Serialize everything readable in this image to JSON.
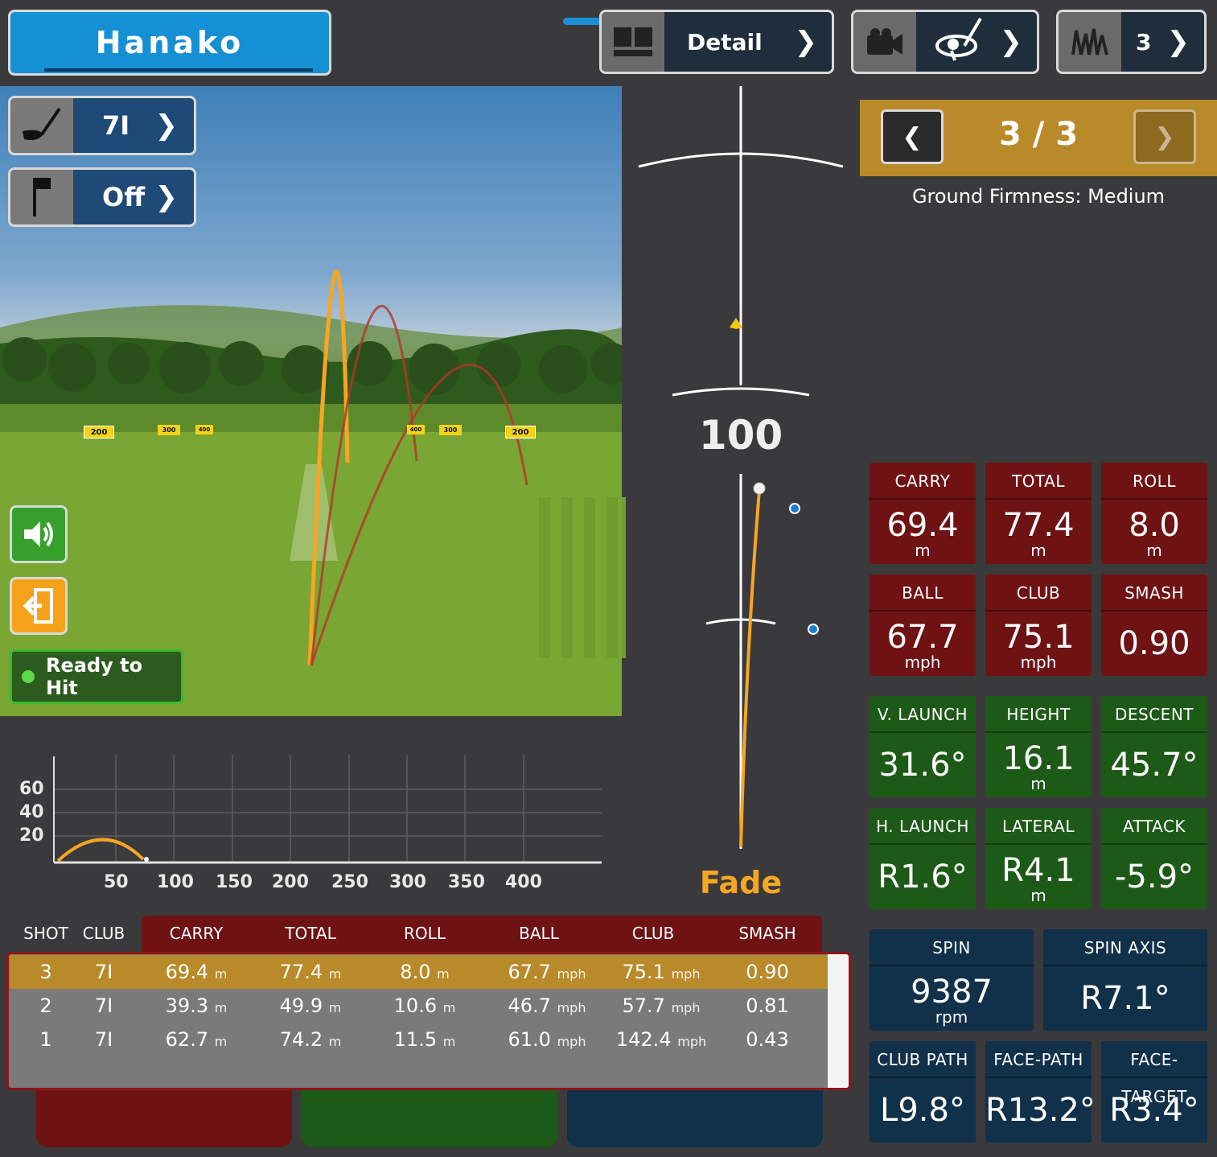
{
  "header": {
    "player_name": "Hanako",
    "detail_label": "Detail",
    "camera_label": "",
    "range_label": "3"
  },
  "side": {
    "club": "7I",
    "pin": "Off",
    "status": "Ready to Hit"
  },
  "target": {
    "distance": "100",
    "shot_shape": "Fade"
  },
  "nav": {
    "page": "3 / 3",
    "ground_firmness": "Ground Firmness: Medium"
  },
  "stats": {
    "carry": {
      "label": "CARRY",
      "value": "69.4",
      "unit": "m"
    },
    "total": {
      "label": "TOTAL",
      "value": "77.4",
      "unit": "m"
    },
    "roll": {
      "label": "ROLL",
      "value": "8.0",
      "unit": "m"
    },
    "ball": {
      "label": "BALL",
      "value": "67.7",
      "unit": "mph"
    },
    "club": {
      "label": "CLUB",
      "value": "75.1",
      "unit": "mph"
    },
    "smash": {
      "label": "SMASH",
      "value": "0.90",
      "unit": ""
    },
    "v_launch": {
      "label": "V. LAUNCH",
      "value": "31.6°",
      "unit": ""
    },
    "height": {
      "label": "HEIGHT",
      "value": "16.1",
      "unit": "m"
    },
    "descent": {
      "label": "DESCENT",
      "value": "45.7°",
      "unit": ""
    },
    "h_launch": {
      "label": "H. LAUNCH",
      "value": "R1.6°",
      "unit": ""
    },
    "lateral": {
      "label": "LATERAL",
      "value": "R4.1",
      "unit": "m"
    },
    "attack": {
      "label": "ATTACK",
      "value": "-5.9°",
      "unit": ""
    },
    "spin": {
      "label": "SPIN",
      "value": "9387",
      "unit": "rpm"
    },
    "spin_axis": {
      "label": "SPIN AXIS",
      "value": "R7.1°",
      "unit": ""
    },
    "club_path": {
      "label": "CLUB PATH",
      "value": "L9.8°",
      "unit": ""
    },
    "face_path": {
      "label": "FACE-PATH",
      "value": "R13.2°",
      "unit": ""
    },
    "face_target": {
      "label": "FACE-TARGET",
      "value": "R3.4°",
      "unit": ""
    }
  },
  "profile_chart": {
    "y_ticks": [
      "60",
      "40",
      "20"
    ],
    "x_ticks": [
      "50",
      "100",
      "150",
      "200",
      "250",
      "300",
      "350",
      "400"
    ]
  },
  "table": {
    "headers": [
      "SHOT",
      "CLUB",
      "CARRY",
      "TOTAL",
      "ROLL",
      "BALL",
      "CLUB",
      "SMASH"
    ],
    "rows": [
      {
        "shot": "3",
        "club": "7I",
        "carry": "69.4",
        "total": "77.4",
        "roll": "8.0",
        "ball": "67.7",
        "clubspd": "75.1",
        "smash": "0.90"
      },
      {
        "shot": "2",
        "club": "7I",
        "carry": "39.3",
        "total": "49.9",
        "roll": "10.6",
        "ball": "46.7",
        "clubspd": "57.7",
        "smash": "0.81"
      },
      {
        "shot": "1",
        "club": "7I",
        "carry": "62.7",
        "total": "74.2",
        "roll": "11.5",
        "ball": "61.0",
        "clubspd": "142.4",
        "smash": "0.43"
      }
    ],
    "unit_m": "m",
    "unit_mph": "mph"
  },
  "range_sign_labels": [
    "200",
    "300",
    "400",
    "400",
    "300",
    "200"
  ],
  "colors": {
    "accent": "#1a8fd8",
    "gold": "#b98a2a",
    "trace": "#f5a623",
    "red_tile": "#6e1214",
    "green_tile": "#1d5a17",
    "blue_tile": "#11304a"
  }
}
